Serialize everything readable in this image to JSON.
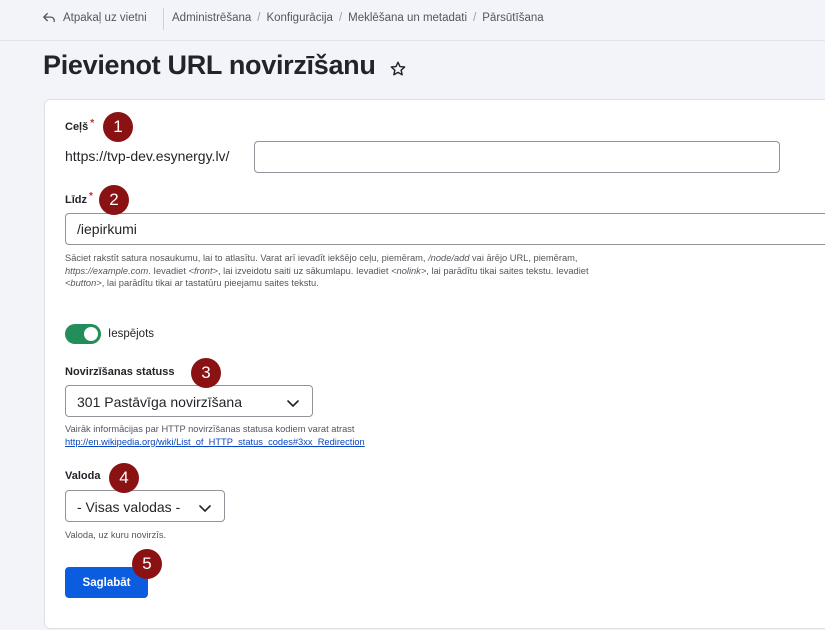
{
  "topbar": {
    "back_label": "Atpakaļ uz vietni",
    "breadcrumbs": [
      "Administrēšana",
      "Konfigurācija",
      "Meklēšana un metadati",
      "Pārsūtīšana"
    ]
  },
  "page": {
    "title": "Pievienot URL novirzīšanu"
  },
  "form": {
    "path": {
      "label": "Ceļš",
      "required_mark": "*",
      "prefix": "https://tvp-dev.esynergy.lv/",
      "value": ""
    },
    "to": {
      "label": "Līdz",
      "required_mark": "*",
      "value": "/iepirkumi",
      "desc_1": "Sāciet rakstīt satura nosaukumu, lai to atlasītu. Varat arī ievadīt iekšējo ceļu, piemēram, ",
      "desc_path": "/node/add",
      "desc_2": " vai ārējo URL, piemēram, ",
      "desc_url": "https://example.com",
      "desc_3": ". Ievadiet ",
      "desc_front": "<front>",
      "desc_4": ", lai izveidotu saiti uz sākumlapu. Ievadiet ",
      "desc_nolink": "<nolink>",
      "desc_5": ", lai parādītu tikai saites tekstu. Ievadiet ",
      "desc_button": "<button>",
      "desc_6": ", lai parādītu tikai ar tastatūru pieejamu saites tekstu."
    },
    "enabled": {
      "label": "Iespējots",
      "checked": true
    },
    "status": {
      "label": "Novirzīšanas statuss",
      "selected": "301 Pastāvīga novirzīšana",
      "desc": "Vairāk informācijas par HTTP novirzīšanas statusa kodiem varat atrast",
      "link": "http://en.wikipedia.org/wiki/List_of_HTTP_status_codes#3xx_Redirection"
    },
    "language": {
      "label": "Valoda",
      "selected": "- Visas valodas -",
      "desc": "Valoda, uz kuru novirzīs."
    },
    "save_label": "Saglabāt"
  },
  "annotations": [
    "1",
    "2",
    "3",
    "4",
    "5"
  ],
  "colors": {
    "primary": "#0b5cde",
    "toggle_on": "#228f5b",
    "badge": "#8a1212",
    "required": "#d72222",
    "link": "#0a46c4"
  }
}
